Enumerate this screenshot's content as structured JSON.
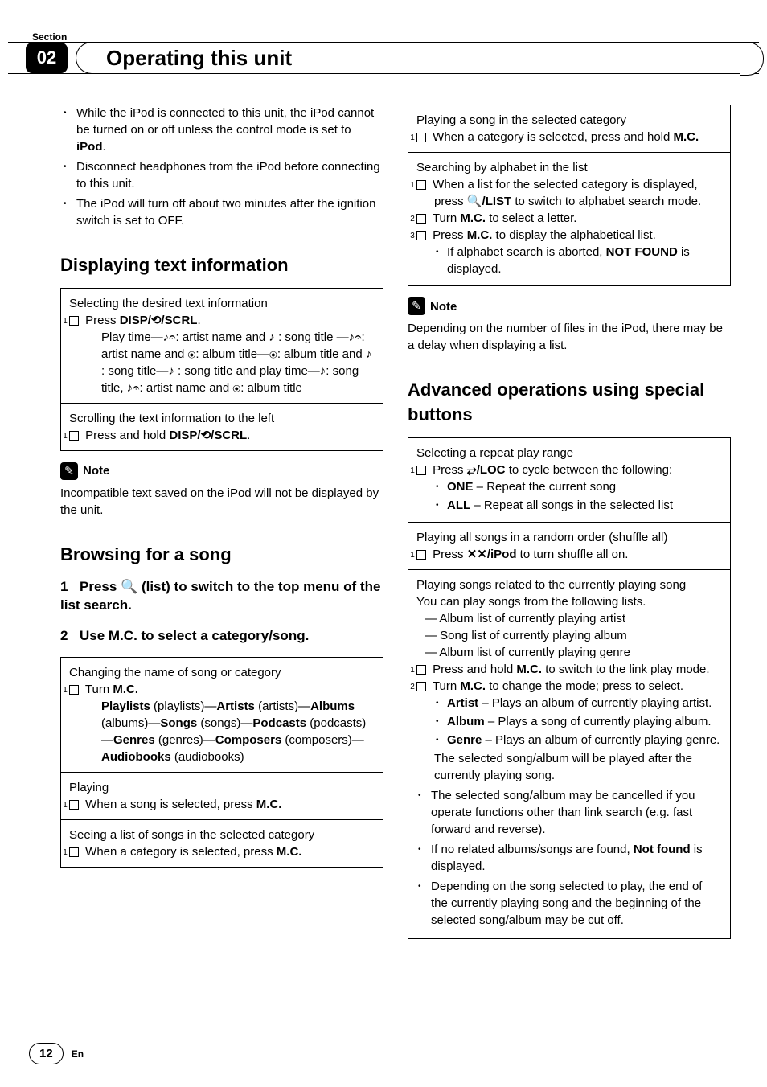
{
  "header": {
    "section_label": "Section",
    "section_num": "02",
    "title": "Operating this unit"
  },
  "left": {
    "intro_bullets": [
      "While the iPod is connected to this unit, the iPod cannot be turned on or off unless the control mode is set to iPod.",
      "Disconnect headphones from the iPod before connecting to this unit.",
      "The iPod will turn off about two minutes after the ignition switch is set to OFF."
    ],
    "disp_heading": "Displaying text information",
    "disp_box1_title": "Selecting the desired text information",
    "disp_box1_step_prefix": "Press ",
    "disp_box1_step_label": "DISP/⟲/SCRL",
    "disp_box1_step_suffix": ".",
    "disp_box1_body": "Play time—♪𝄐: artist name and ♪ : song title —♪𝄐: artist name and ⦿: album title—⦿: album title and ♪ : song title—♪ : song title and play time—♪: song title, ♪𝄐: artist name and ⦿: album title",
    "disp_box2_title": "Scrolling the text information to the left",
    "disp_box2_step_prefix": "Press and hold ",
    "disp_box2_step_label": "DISP/⟲/SCRL",
    "disp_box2_step_suffix": ".",
    "note_label": "Note",
    "note_text": "Incompatible text saved on the iPod will not be displayed by the unit.",
    "browse_heading": "Browsing for a song",
    "browse_step1_num": "1",
    "browse_step1_text": "Press 🔍 (list) to switch to the top menu of the list search.",
    "browse_step2_num": "2",
    "browse_step2_text": "Use M.C. to select a category/song.",
    "browse_box1_title": "Changing the name of song or category",
    "browse_box1_step": "Turn M.C.",
    "browse_box1_body_parts": [
      {
        "b": "Playlists"
      },
      {
        "t": " (playlists)—"
      },
      {
        "b": "Artists"
      },
      {
        "t": " (artists)—"
      },
      {
        "b": "Albums"
      },
      {
        "t": " (albums)—"
      },
      {
        "b": "Songs"
      },
      {
        "t": " (songs)—"
      },
      {
        "b": "Podcasts"
      },
      {
        "t": " (podcasts)—"
      },
      {
        "b": "Genres"
      },
      {
        "t": " (genres)—"
      },
      {
        "b": "Composers"
      },
      {
        "t": " (composers)—"
      },
      {
        "b": "Audiobooks"
      },
      {
        "t": " (audiobooks)"
      }
    ],
    "browse_box2_title": "Playing",
    "browse_box2_step_prefix": "When a song is selected, press ",
    "browse_box2_step_bold": "M.C.",
    "browse_box3_title": "Seeing a list of songs in the selected category",
    "browse_box3_step_prefix": "When a category is selected, press ",
    "browse_box3_step_bold": "M.C."
  },
  "right": {
    "box_play_title": "Playing a song in the selected category",
    "box_play_step_prefix": "When a category is selected, press and hold ",
    "box_play_step_bold": "M.C.",
    "box_search_title": "Searching by alphabet in the list",
    "box_search_s1_prefix": "When a list for the selected category is displayed, press ",
    "box_search_s1_bold": "🔍/LIST",
    "box_search_s1_suffix": " to switch to alphabet search mode.",
    "box_search_s2_prefix": "Turn ",
    "box_search_s2_bold": "M.C.",
    "box_search_s2_suffix": " to select a letter.",
    "box_search_s3_prefix": "Press ",
    "box_search_s3_bold": "M.C.",
    "box_search_s3_suffix": " to display the alphabetical list.",
    "box_search_bullet_prefix": "If alphabet search is aborted, ",
    "box_search_bullet_bold": "NOT FOUND",
    "box_search_bullet_suffix": " is displayed.",
    "note_label": "Note",
    "note_text": "Depending on the number of files in the iPod, there may be a delay when displaying a list.",
    "adv_heading": "Advanced operations using special buttons",
    "adv_b1_title": "Selecting a repeat play range",
    "adv_b1_step_prefix": "Press ",
    "adv_b1_step_bold": "⥂/LOC",
    "adv_b1_step_suffix": " to cycle between the following:",
    "adv_b1_opt1_b": "ONE",
    "adv_b1_opt1_t": " – Repeat the current song",
    "adv_b1_opt2_b": "ALL",
    "adv_b1_opt2_t": " – Repeat all songs in the selected list",
    "adv_b2_title": "Playing all songs in a random order (shuffle all)",
    "adv_b2_step_prefix": "Press ",
    "adv_b2_step_bold": "✕✕/iPod",
    "adv_b2_step_suffix": " to turn shuffle all on.",
    "adv_b3_title": "Playing songs related to the currently playing song",
    "adv_b3_intro": "You can play songs from the following lists.",
    "adv_b3_dashes": [
      "— Album list of currently playing artist",
      "— Song list of currently playing album",
      "— Album list of currently playing genre"
    ],
    "adv_b3_s1_prefix": "Press and hold ",
    "adv_b3_s1_bold": "M.C.",
    "adv_b3_s1_suffix": " to switch to the link play mode.",
    "adv_b3_s2_prefix": "Turn ",
    "adv_b3_s2_bold": "M.C.",
    "adv_b3_s2_suffix": " to change the mode; press to select.",
    "adv_b3_opts": [
      {
        "b": "Artist",
        "t": " – Plays an album of currently playing artist."
      },
      {
        "b": "Album",
        "t": " – Plays a song of currently playing album."
      },
      {
        "b": "Genre",
        "t": " – Plays an album of currently playing genre."
      }
    ],
    "adv_b3_after": "The selected song/album will be played after the currently playing song.",
    "adv_b3_bullets": [
      "The selected song/album may be cancelled if you operate functions other than link search (e.g. fast forward and reverse).",
      "If no related albums/songs are found, Not found is displayed.",
      "Depending on the song selected to play, the end of the currently playing song and the beginning of the selected song/album may be cut off."
    ],
    "adv_b3_bullet2_prefix": "If no related albums/songs are found, ",
    "adv_b3_bullet2_bold": "Not found",
    "adv_b3_bullet2_suffix": " is displayed."
  },
  "footer": {
    "page": "12",
    "lang": "En"
  }
}
